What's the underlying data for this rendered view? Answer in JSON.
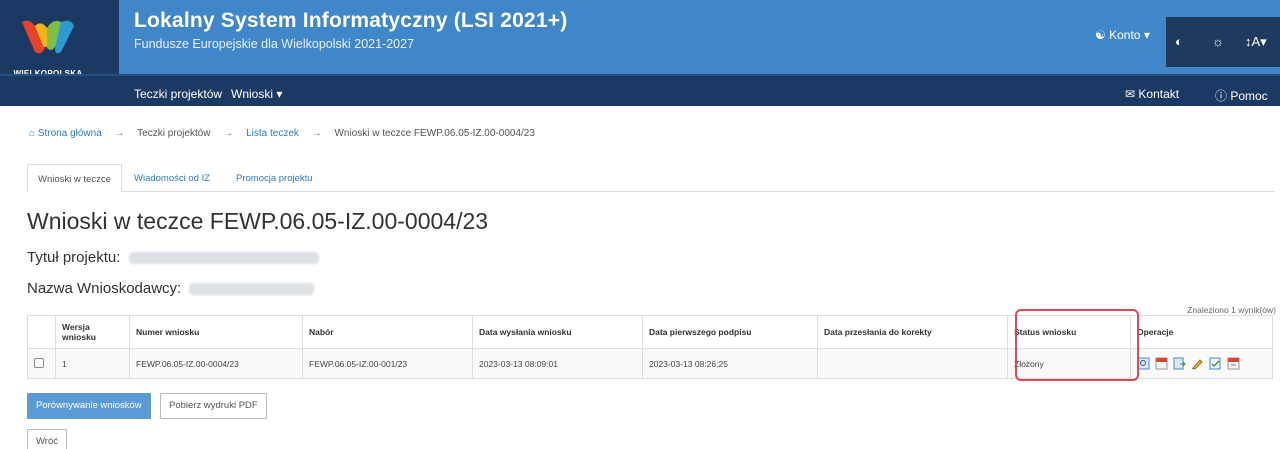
{
  "header": {
    "logo_text": "WIELKOPOLSKA",
    "title": "Lokalny System Informatyczny (LSI 2021+)",
    "subtitle": "Fundusze Europejskie dla Wielkopolski 2021-2027",
    "account_label": "Konto",
    "font_size_label": "A"
  },
  "nav": {
    "items": [
      "Teczki projektów",
      "Wnioski"
    ],
    "contact": "Kontakt",
    "help": "Pomoc"
  },
  "breadcrumb": [
    "Strona główna",
    "Teczki projektów",
    "Lista teczek",
    "Wnioski w teczce FEWP.06.05-IZ.00-0004/23"
  ],
  "tabs": [
    "Wnioski w teczce",
    "Wiadomości od IZ",
    "Promocja projektu"
  ],
  "page": {
    "title": "Wnioski w teczce FEWP.06.05-IZ.00-0004/23",
    "project_title_label": "Tytuł projektu:",
    "applicant_label": "Nazwa Wnioskodawcy:",
    "results": "Znaleziono 1 wynik(ów)"
  },
  "table": {
    "headers": [
      "Wersja wniosku",
      "Numer wniosku",
      "Nabór",
      "Data wysłania wniosku",
      "Data pierwszego podpisu",
      "Data przesłania do korekty",
      "Status wniosku",
      "Operacje"
    ],
    "rows": [
      {
        "version": "1",
        "number": "FEWP.06.05-IZ.00-0004/23",
        "call": "FEWP.06.05-IZ.00-001/23",
        "sent_date": "2023-03-13 08:09:01",
        "first_signature": "2023-03-13 08:26:25",
        "correction_date": "",
        "status": "Złożony"
      }
    ]
  },
  "buttons": {
    "compare": "Porównywanie wniosków",
    "download_pdf": "Pobierz wydruki PDF",
    "back": "Wróć"
  },
  "colors": {
    "header_blue": "#3f87c8",
    "nav_dark": "#1b3a63",
    "link": "#2b7bc3",
    "highlight": "#e24650"
  }
}
